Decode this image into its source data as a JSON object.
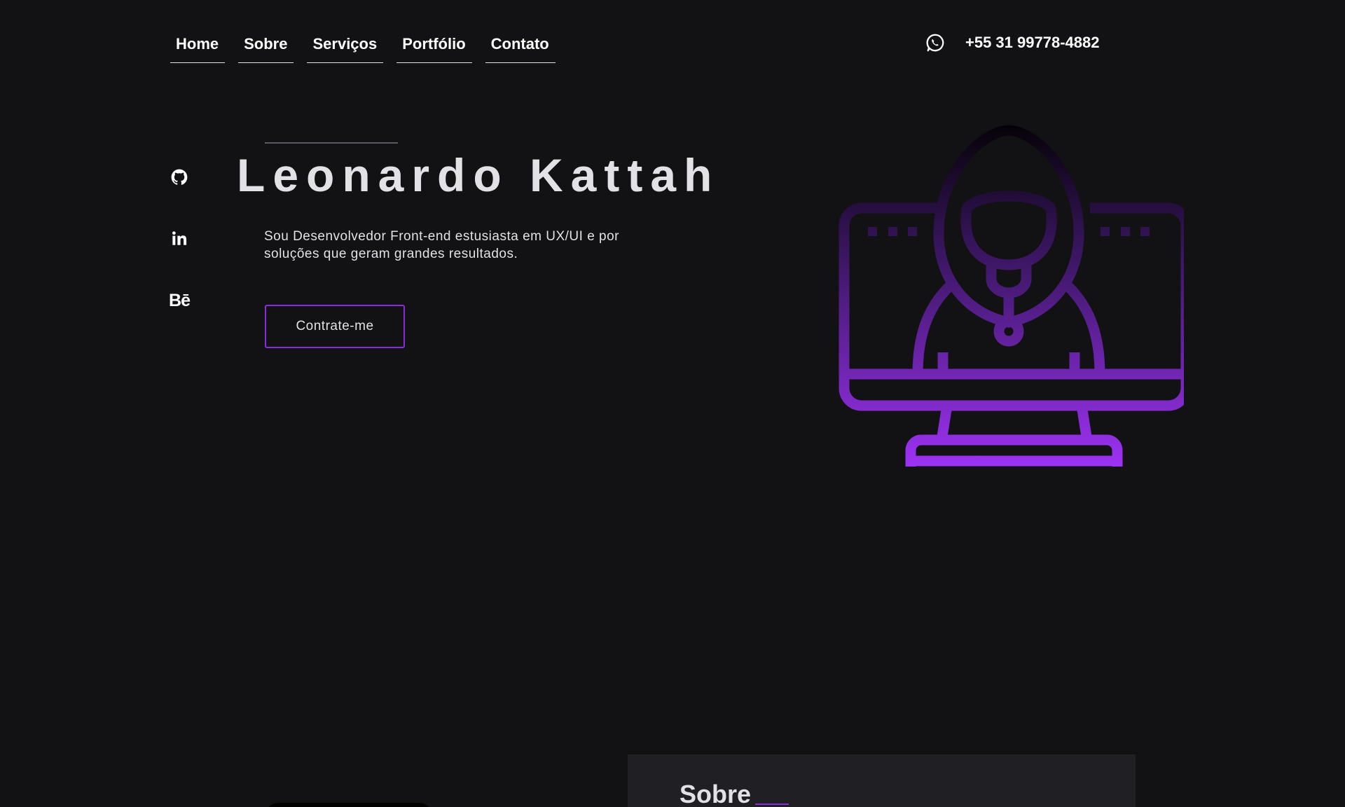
{
  "nav": {
    "items": [
      {
        "label": "Home"
      },
      {
        "label": "Sobre"
      },
      {
        "label": "Serviços"
      },
      {
        "label": "Portfólio"
      },
      {
        "label": "Contato"
      }
    ]
  },
  "contact": {
    "phone": "+55 31 99778-4882",
    "icon": "whatsapp-icon"
  },
  "social": {
    "items": [
      {
        "icon": "github-icon"
      },
      {
        "icon": "linkedin-icon",
        "text": "in"
      },
      {
        "icon": "behance-icon",
        "text": "Bē"
      }
    ]
  },
  "hero": {
    "title": "Leonardo Kattah",
    "description": "Sou Desenvolvedor Front-end estusiasta em UX/UI e por soluções que geram grandes resultados.",
    "cta": "Contrate-me",
    "illustration": "hacker-computer-icon"
  },
  "about": {
    "title": "Sobre"
  },
  "colors": {
    "background": "#121214",
    "card": "#202024",
    "accent": "#8a2be2",
    "text": "#e1e1e6"
  }
}
